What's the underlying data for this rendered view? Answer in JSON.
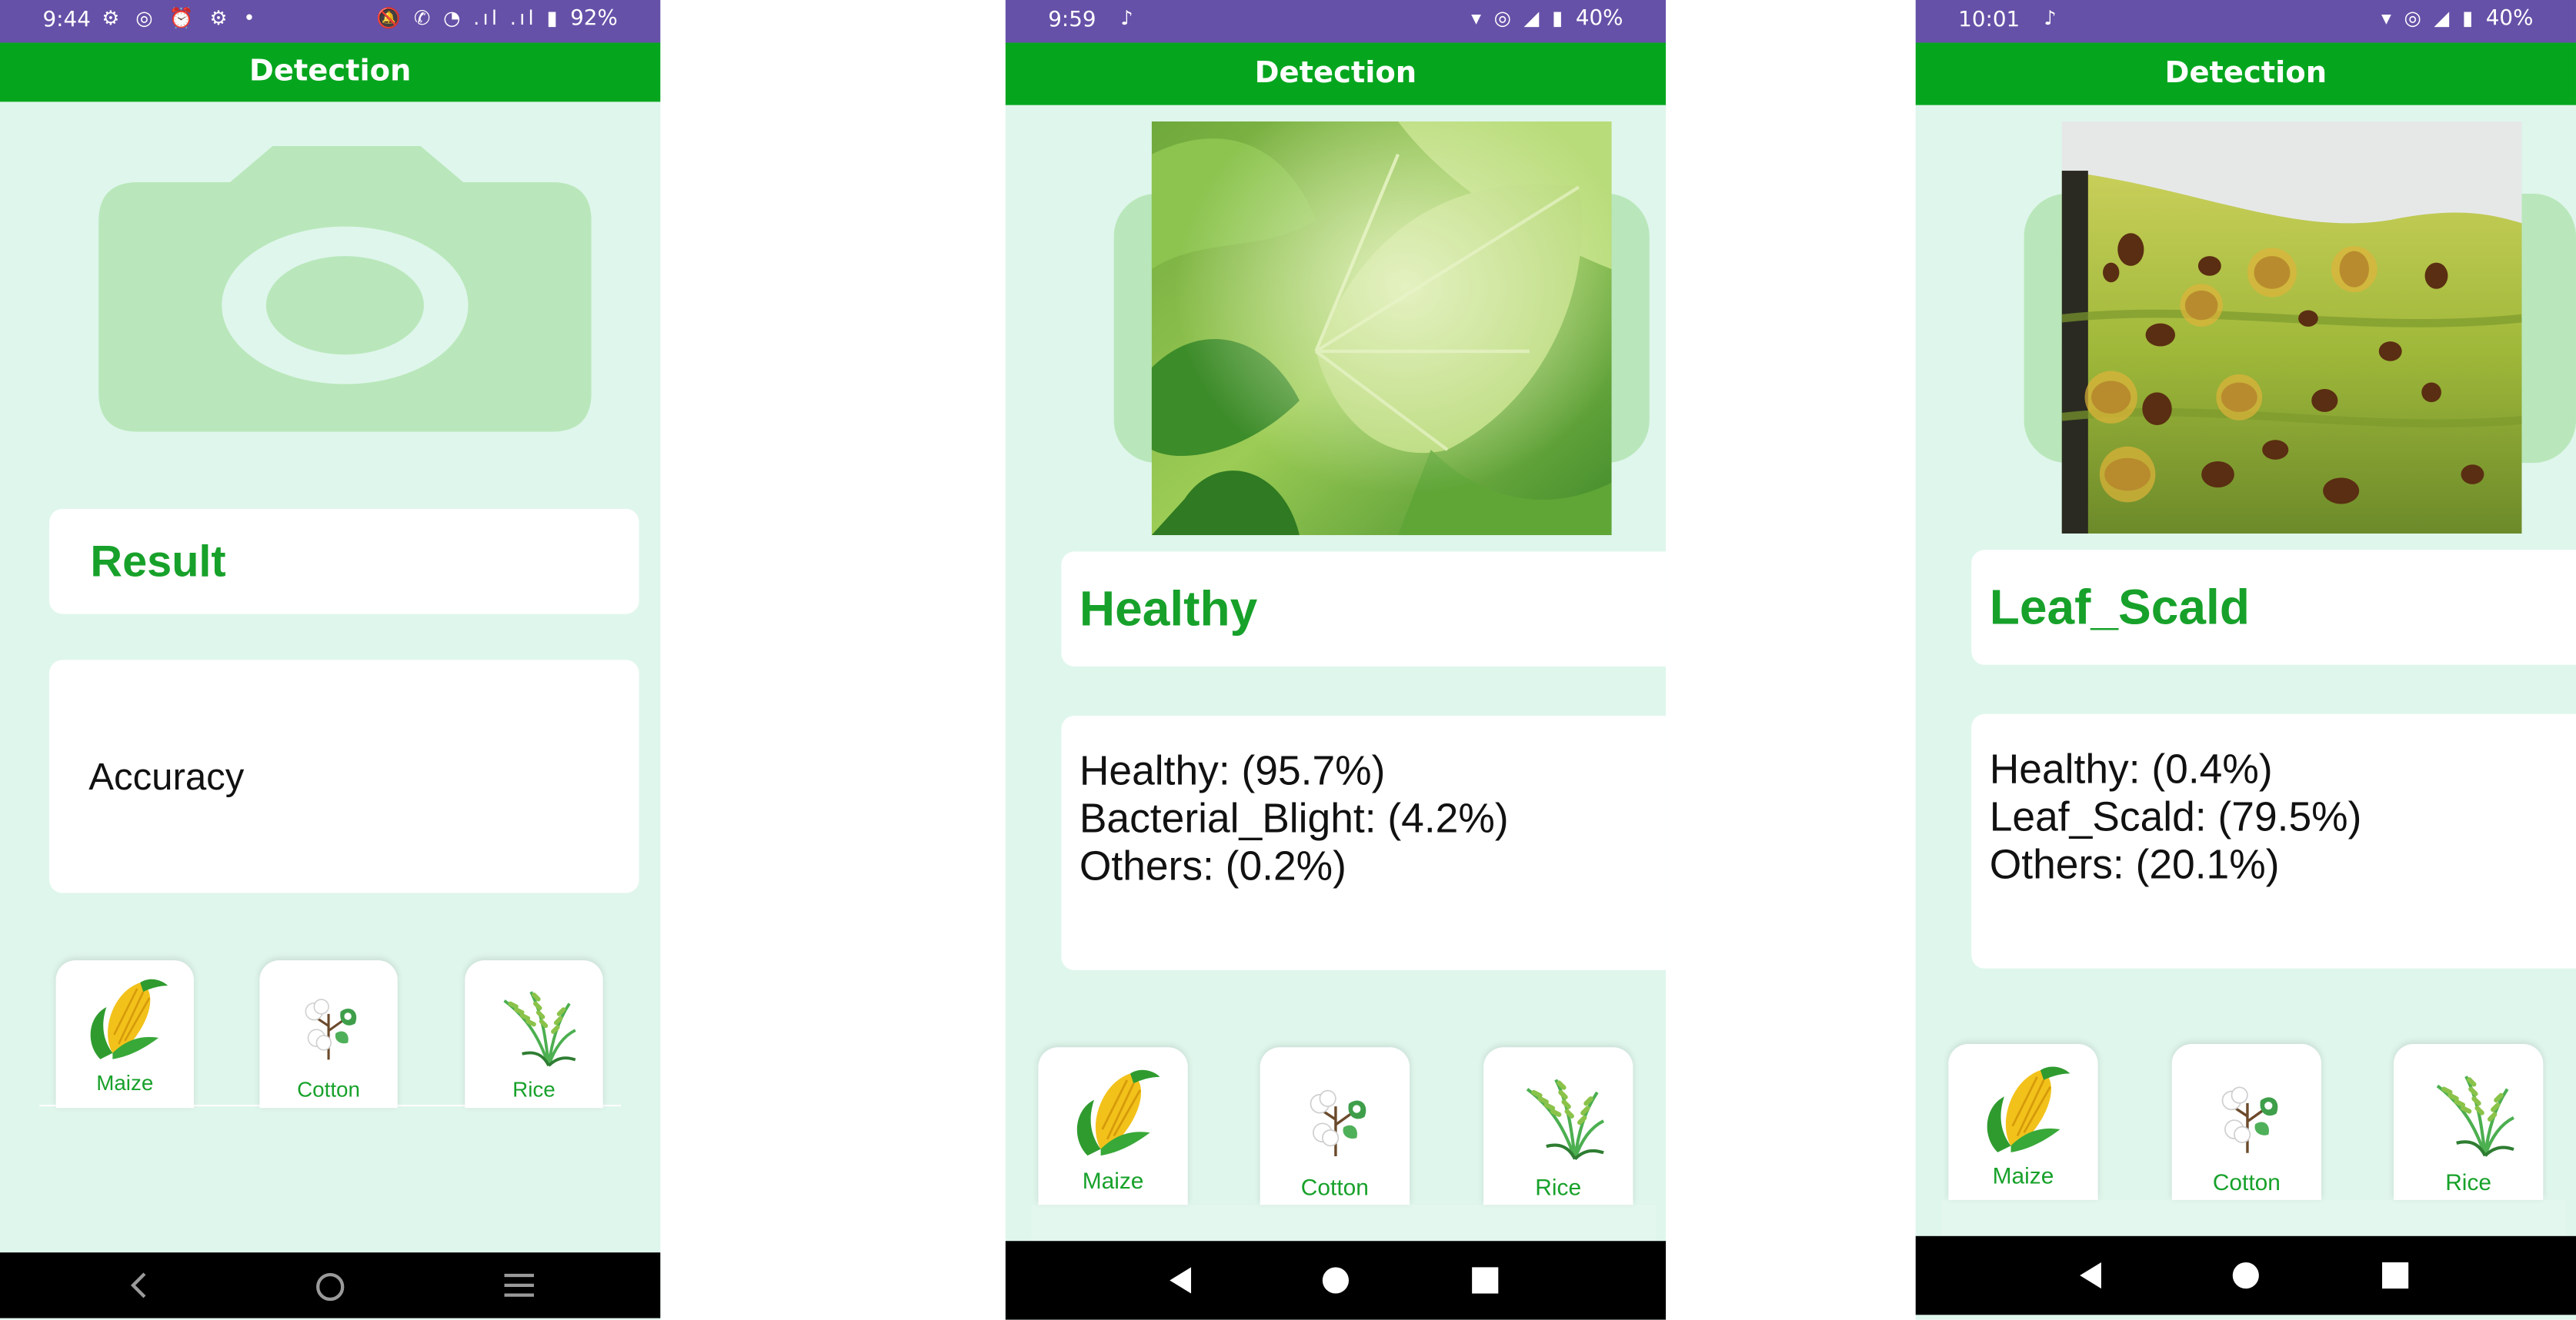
{
  "screens": [
    {
      "status_time": "9:44",
      "status_battery": "92%",
      "title": "Detection",
      "result": "Result",
      "accuracy_lines": [
        "Accuracy"
      ],
      "crops": [
        {
          "label": "Maize",
          "icon": "maize-icon"
        },
        {
          "label": "Cotton",
          "icon": "cotton-icon"
        },
        {
          "label": "Rice",
          "icon": "rice-icon"
        }
      ],
      "nav": [
        "back-icon",
        "home-icon",
        "menu-icon"
      ]
    },
    {
      "status_time": "9:59",
      "status_battery": "40%",
      "title": "Detection",
      "result": "Healthy",
      "accuracy_lines": [
        "Healthy: (95.7%)",
        "Bacterial_Blight: (4.2%)",
        "Others: (0.2%)"
      ],
      "crops": [
        {
          "label": "Maize",
          "icon": "maize-icon"
        },
        {
          "label": "Cotton",
          "icon": "cotton-icon"
        },
        {
          "label": "Rice",
          "icon": "rice-icon"
        }
      ],
      "nav": [
        "back-icon",
        "home-icon",
        "recents-icon"
      ]
    },
    {
      "status_time": "10:01",
      "status_battery": "40%",
      "title": "Detection",
      "result": "Leaf_Scald",
      "accuracy_lines": [
        "Healthy: (0.4%)",
        "Leaf_Scald: (79.5%)",
        "Others: (20.1%)"
      ],
      "crops": [
        {
          "label": "Maize",
          "icon": "maize-icon"
        },
        {
          "label": "Cotton",
          "icon": "cotton-icon"
        },
        {
          "label": "Rice",
          "icon": "rice-icon"
        }
      ],
      "nav": [
        "back-icon",
        "home-icon",
        "recents-icon"
      ]
    }
  ],
  "colors": {
    "status_bar": "#6651a8",
    "app_bar": "#05a61e",
    "background": "#dff6ec",
    "accent_text": "#17a12a",
    "camera_placeholder": "#b9e7bb"
  }
}
